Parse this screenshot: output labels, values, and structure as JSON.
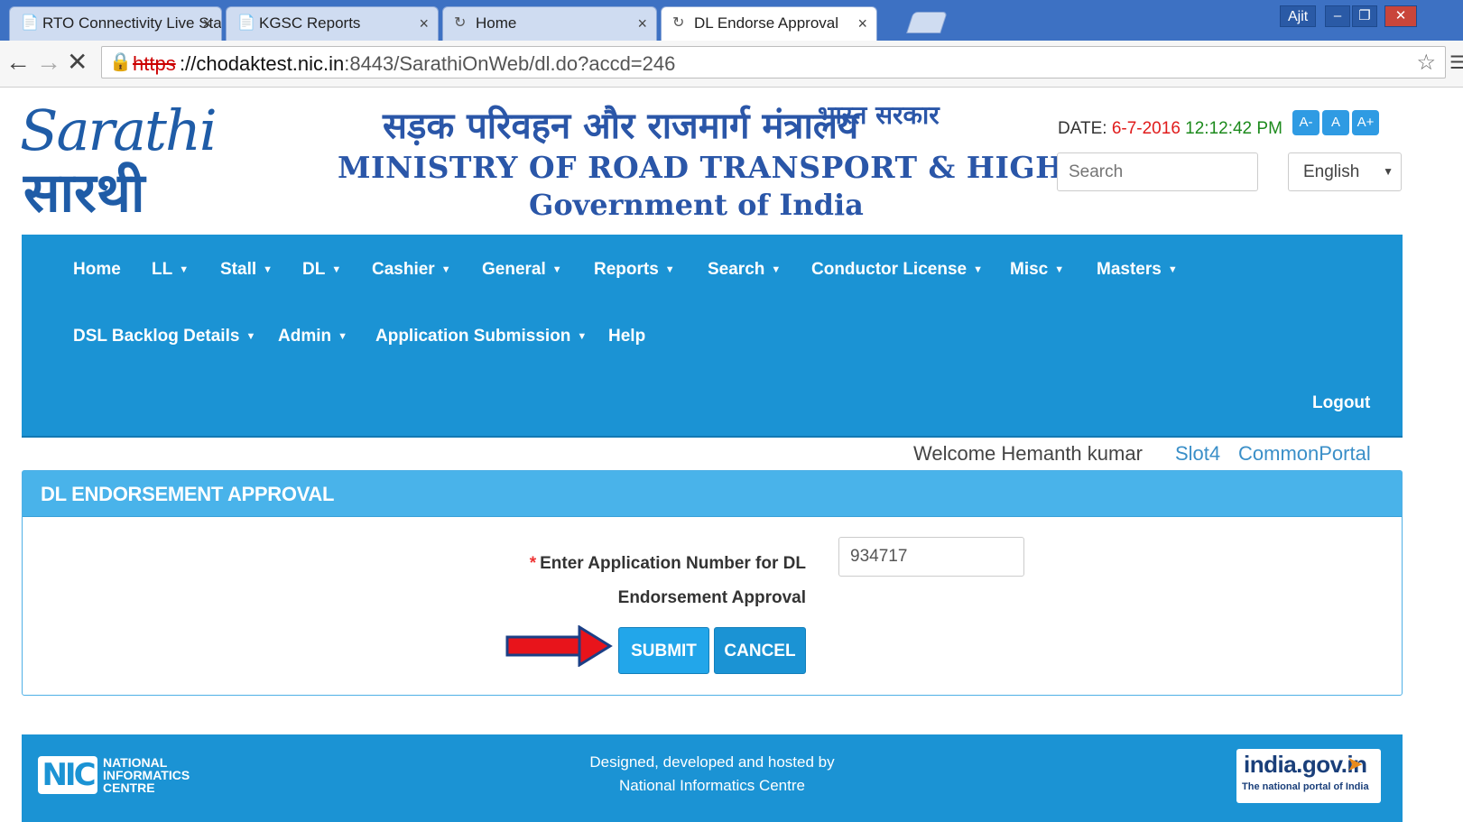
{
  "browser": {
    "tabs": [
      {
        "title": "RTO Connectivity Live Sta",
        "icon": "page-icon"
      },
      {
        "title": "KGSC Reports",
        "icon": "page-icon"
      },
      {
        "title": "Home",
        "icon": "loading-icon"
      },
      {
        "title": "DL Endorse Approval",
        "icon": "loading-icon"
      }
    ],
    "close_glyph": "×",
    "user": "Ajit",
    "url_scheme": "https",
    "url_host": "://chodaktest.nic.in",
    "url_path": ":8443/SarathiOnWeb/dl.do?accd=246"
  },
  "header": {
    "logo_en": "Sarathi",
    "logo_hi": "सारथी",
    "hindi_title": "सड़क परिवहन और राजमार्ग मंत्रालय",
    "hindi_sub": "भारत सरकार",
    "ministry": "MINISTRY OF ROAD TRANSPORT & HIGHWAYS",
    "govt": "Government of India",
    "date_label": "DATE: ",
    "date_value": "6-7-2016",
    "time_value": " 12:12:42 PM",
    "font_buttons": [
      "A-",
      "A",
      "A+"
    ],
    "search_placeholder": "Search",
    "language": "English"
  },
  "nav": {
    "row1": [
      {
        "label": "Home",
        "dropdown": false
      },
      {
        "label": "LL",
        "dropdown": true
      },
      {
        "label": "Stall",
        "dropdown": true
      },
      {
        "label": "DL",
        "dropdown": true
      },
      {
        "label": "Cashier",
        "dropdown": true
      },
      {
        "label": "General",
        "dropdown": true
      },
      {
        "label": "Reports",
        "dropdown": true
      },
      {
        "label": "Search",
        "dropdown": true
      },
      {
        "label": "Conductor License",
        "dropdown": true
      },
      {
        "label": "Misc",
        "dropdown": true
      },
      {
        "label": "Masters",
        "dropdown": true
      }
    ],
    "row2": [
      {
        "label": "DSL Backlog Details",
        "dropdown": true
      },
      {
        "label": "Admin",
        "dropdown": true
      },
      {
        "label": "Application Submission",
        "dropdown": true
      },
      {
        "label": "Help",
        "dropdown": false
      }
    ],
    "logout": "Logout"
  },
  "welcome": {
    "text": "Welcome Hemanth kumar",
    "slot": "Slot4",
    "portal": "CommonPortal"
  },
  "panel": {
    "title": "DL ENDORSEMENT APPROVAL",
    "required_mark": "*",
    "field_label": "Enter Application Number for DL Endorsement Approval",
    "field_value": "934717",
    "submit": "SUBMIT",
    "cancel": "CANCEL"
  },
  "footer": {
    "nic_mark": "NIC",
    "nic_line1": "NATIONAL",
    "nic_line2": "INFORMATICS",
    "nic_line3": "CENTRE",
    "credit_line1": "Designed, developed and hosted by",
    "credit_line2": "National Informatics Centre",
    "india_portal": "india.gov.in",
    "india_tagline": "The national portal of India"
  },
  "colors": {
    "nav_blue": "#1b93d4",
    "panel_head": "#49b3ea",
    "date_red": "#e01b1b",
    "time_green": "#1c8a1c",
    "arrow_red": "#e8141b"
  }
}
